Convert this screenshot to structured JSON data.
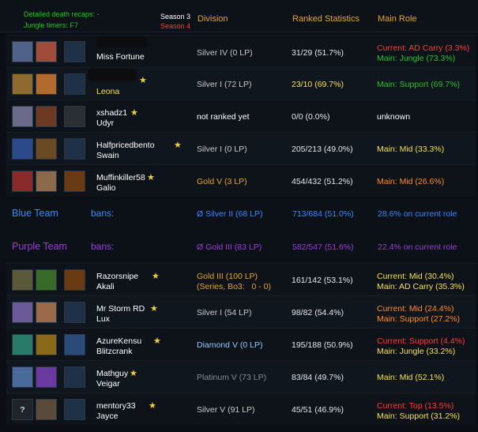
{
  "topbar": {
    "hint1": "Detailed death recaps: -",
    "hint2": "Jungle timers: F7",
    "season3": "Season 3",
    "season4": "Season 4",
    "col_division": "Division",
    "col_ranked": "Ranked Statistics",
    "col_role": "Main Role"
  },
  "blue_team": {
    "label": "Blue Team",
    "bans": "bans:",
    "avg_division": "Ø Silver II (68 LP)",
    "avg_ranked": "713/684 (51.0%)",
    "role_summary": "28.6% on current role"
  },
  "purple_team": {
    "label": "Purple Team",
    "bans": "bans:",
    "avg_division": "Ø Gold III (83 LP)",
    "avg_ranked": "582/547 (51.6%)",
    "role_summary": "22.4% on current role"
  },
  "blue_players": [
    {
      "summoner": "",
      "champion": "Miss Fortune",
      "star": false,
      "division": "Silver IV (0 LP)",
      "ranked": "31/29 (51.7%)",
      "role1": "Current: AD Carry (3.3%)",
      "role2": "Main: Jungle (73.3%)"
    },
    {
      "summoner": "",
      "champion": "Leona",
      "star": true,
      "division": "Silver I (72 LP)",
      "ranked": "23/10 (69.7%)",
      "role1": "Main: Support (69.7%)",
      "role2": ""
    },
    {
      "summoner": "xshadz1",
      "champion": "Udyr",
      "star": true,
      "division": "not ranked yet",
      "ranked": "0/0 (0.0%)",
      "role1": "unknown",
      "role2": ""
    },
    {
      "summoner": "Halfpricedbento",
      "champion": "Swain",
      "star": true,
      "division": "Silver I (0 LP)",
      "ranked": "205/213 (49.0%)",
      "role1": "Main: Mid (33.3%)",
      "role2": ""
    },
    {
      "summoner": "Muffinkiller58",
      "champion": "Galio",
      "star": true,
      "division": "Gold V (3 LP)",
      "ranked": "454/432 (51.2%)",
      "role1": "Main: Mid (26.6%)",
      "role2": ""
    }
  ],
  "purple_players": [
    {
      "summoner": "Razorsnipe",
      "champion": "Akali",
      "star": true,
      "division": "Gold III (100 LP)",
      "division2": "(Series, Bo3:   0 - 0)",
      "ranked": "161/142 (53.1%)",
      "role1": "Current: Mid (30.4%)",
      "role2": "Main: AD Carry (35.3%)"
    },
    {
      "summoner": "Mr Storm RD",
      "champion": "Lux",
      "star": true,
      "division": "Silver I (54 LP)",
      "ranked": "98/82 (54.4%)",
      "role1": "Current: Mid (24.4%)",
      "role2": "Main: Support (27.2%)"
    },
    {
      "summoner": "AzureKensu",
      "champion": "Blitzcrank",
      "star": true,
      "division": "Diamond V (0 LP)",
      "ranked": "195/188 (50.9%)",
      "role1": "Current: Support (4.4%)",
      "role2": "Main: Jungle (33.2%)"
    },
    {
      "summoner": "Mathguy",
      "champion": "Veigar",
      "star": true,
      "division": "Platinum V (73 LP)",
      "ranked": "83/84 (49.7%)",
      "role1": "Main: Mid (52.1%)",
      "role2": ""
    },
    {
      "summoner": "mentory33",
      "champion": "Jayce",
      "star": true,
      "division": "Silver V (91 LP)",
      "ranked": "45/51 (46.9%)",
      "role1": "Current: Top (13.5%)",
      "role2": "Main: Support (31.2%)"
    }
  ],
  "colors": {
    "gold": "#e3a62a",
    "silver": "#c8c8c8",
    "diamond": "#8fc7ff",
    "platinum": "#7b8c95",
    "red": "#ff3b30",
    "green": "#2fbf2f",
    "yellow": "#f3e04a",
    "orange": "#ff8a2a",
    "blue": "#3a86ff",
    "purple": "#9b3bd6"
  }
}
